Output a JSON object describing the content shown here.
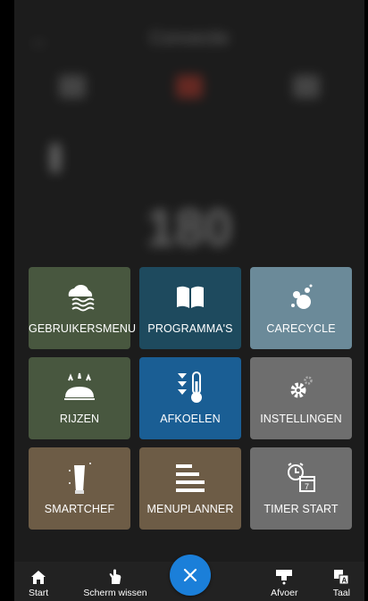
{
  "background": {
    "title": "Convectie",
    "temperature": "180"
  },
  "tiles": [
    {
      "label": "GEBRUIKERSMENU",
      "icon": "cloud-steam-icon",
      "color": "#48573f"
    },
    {
      "label": "PROGRAMMA'S",
      "icon": "book-icon",
      "color": "#1e4a5e"
    },
    {
      "label": "CARECYCLE",
      "icon": "bubbles-icon",
      "color": "#6b8a99"
    },
    {
      "label": "RIJZEN",
      "icon": "bread-rise-icon",
      "color": "#48573f"
    },
    {
      "label": "AFKOELEN",
      "icon": "cooling-thermometer-icon",
      "color": "#1a5e94"
    },
    {
      "label": "INSTELLINGEN",
      "icon": "gears-icon",
      "color": "#6e6e6e"
    },
    {
      "label": "SMARTCHEF",
      "icon": "chef-hat-icon",
      "color": "#6d5c46"
    },
    {
      "label": "MENUPLANNER",
      "icon": "menu-list-icon",
      "color": "#6d5c46"
    },
    {
      "label": "TIMER START",
      "icon": "alarm-calendar-icon",
      "color": "#6e6e6e"
    }
  ],
  "bottom_nav": {
    "start": "Start",
    "clear_screen": "Scherm wissen",
    "drain": "Afvoer",
    "language": "Taal"
  },
  "fab": {
    "icon": "close-icon",
    "color": "#1b7fd9"
  }
}
